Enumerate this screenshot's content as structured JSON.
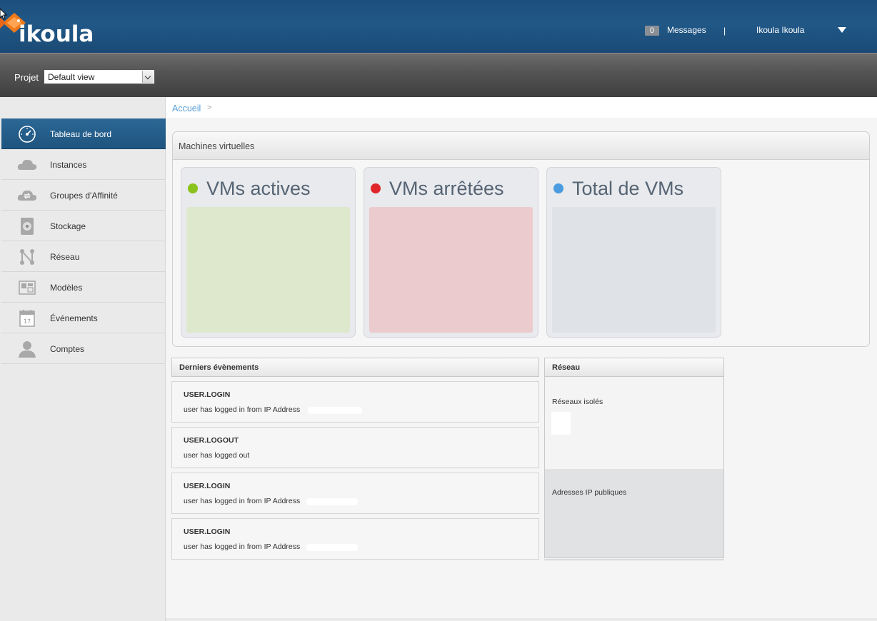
{
  "header": {
    "logo_text": "ikoula",
    "messages_count": "0",
    "messages_label": "Messages",
    "separator": "|",
    "user_name": "Ikoula Ikoula",
    "brand_color": "#215887",
    "logo_accent_color": "#f07a1a"
  },
  "project_bar": {
    "label": "Projet",
    "selected": "Default view"
  },
  "sidebar": {
    "items": [
      {
        "label": "Tableau de bord",
        "icon": "dashboard-gauge-icon",
        "active": true
      },
      {
        "label": "Instances",
        "icon": "cloud-icon",
        "active": false
      },
      {
        "label": "Groupes d'Affinité",
        "icon": "cloud-sync-icon",
        "active": false
      },
      {
        "label": "Stockage",
        "icon": "disk-icon",
        "active": false
      },
      {
        "label": "Réseau",
        "icon": "network-icon",
        "active": false
      },
      {
        "label": "Modèles",
        "icon": "template-icon",
        "active": false
      },
      {
        "label": "Événements",
        "icon": "calendar-icon",
        "active": false
      },
      {
        "label": "Comptes",
        "icon": "user-icon",
        "active": false
      }
    ],
    "calendar_day": "17"
  },
  "breadcrumb": {
    "home": "Accueil",
    "separator": ">"
  },
  "vm_panel": {
    "title": "Machines virtuelles",
    "cards": [
      {
        "title": "VMs actives",
        "dot_color": "#8cc21c",
        "fill_color": "#dde8cd"
      },
      {
        "title": "VMs arrêtées",
        "dot_color": "#e0262b",
        "fill_color": "#ebcbce"
      },
      {
        "title": "Total de VMs",
        "dot_color": "#4a9be0",
        "fill_color": "#dfe2e6"
      }
    ]
  },
  "events": {
    "title": "Derniers évènements",
    "items": [
      {
        "type": "USER.LOGIN",
        "desc": "user has logged in from IP Address"
      },
      {
        "type": "USER.LOGOUT",
        "desc": "user has logged out"
      },
      {
        "type": "USER.LOGIN",
        "desc": "user has logged in from IP Address"
      },
      {
        "type": "USER.LOGIN",
        "desc": "user has logged in from IP Address"
      }
    ]
  },
  "network": {
    "title": "Réseau",
    "isolated_label": "Réseaux isolés",
    "public_ip_label": "Adresses IP publiques"
  }
}
